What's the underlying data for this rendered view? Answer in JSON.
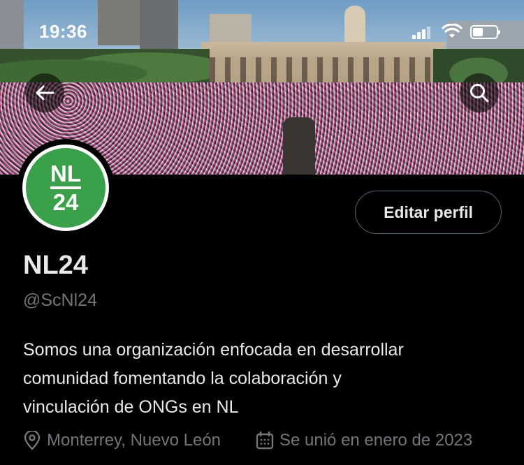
{
  "status_bar": {
    "time": "19:36",
    "icons": [
      "signal-icon",
      "wifi-icon",
      "battery-icon"
    ]
  },
  "header": {
    "back_icon": "arrow-left-icon",
    "search_icon": "search-icon"
  },
  "banner": {
    "description_icon": "banner-photo"
  },
  "avatar": {
    "logo_top": "NL",
    "logo_bottom": "24",
    "logo_color": "#3aa14a"
  },
  "profile": {
    "edit_label": "Editar perfil",
    "name": "NL24",
    "handle": "@ScNl24",
    "bio_lines": [
      "Somos una organización enfocada en desarrollar",
      "comunidad fomentando la colaboración y",
      "vinculación de ONGs en NL"
    ],
    "location": "Monterrey, Nuevo León",
    "joined": "Se unió en enero de 2023"
  },
  "colors": {
    "background": "#000000",
    "text": "#e7e9ea",
    "muted": "#71767b",
    "border": "#536471"
  }
}
